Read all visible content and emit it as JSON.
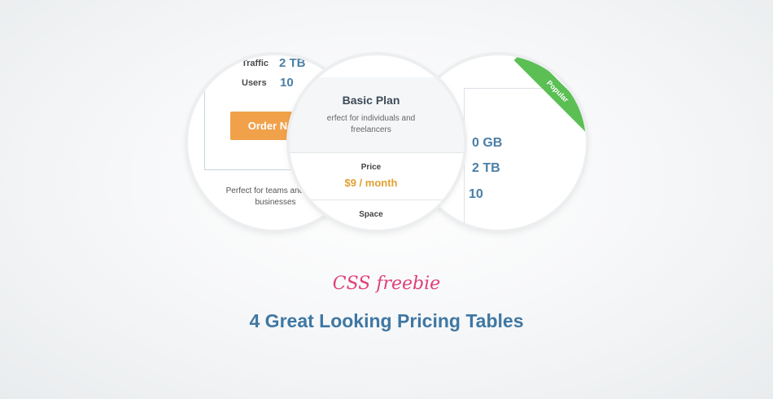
{
  "circle_left": {
    "traffic_label": "Traffic",
    "traffic_value": "2 TB",
    "users_label": "Users",
    "users_value": "10",
    "order_button": "Order Now",
    "description": "Perfect for teams and small businesses"
  },
  "circle_middle": {
    "plan_title": "Basic Plan",
    "plan_description": "erfect for individuals and freelancers",
    "price_label": "Price",
    "price_value": "$9 / month",
    "space_label": "Space"
  },
  "circle_right": {
    "ribbon": "Popular",
    "space_value": "0 GB",
    "traffic_value": "2 TB",
    "users_value": "10"
  },
  "subtitle": "CSS freebie",
  "title": "4 Great Looking Pricing Tables",
  "colors": {
    "accent_blue": "#3f77a3",
    "accent_pink": "#e0417a",
    "button_orange": "#f0a14a",
    "ribbon_green": "#5bbf54",
    "price_gold": "#e2a032"
  }
}
